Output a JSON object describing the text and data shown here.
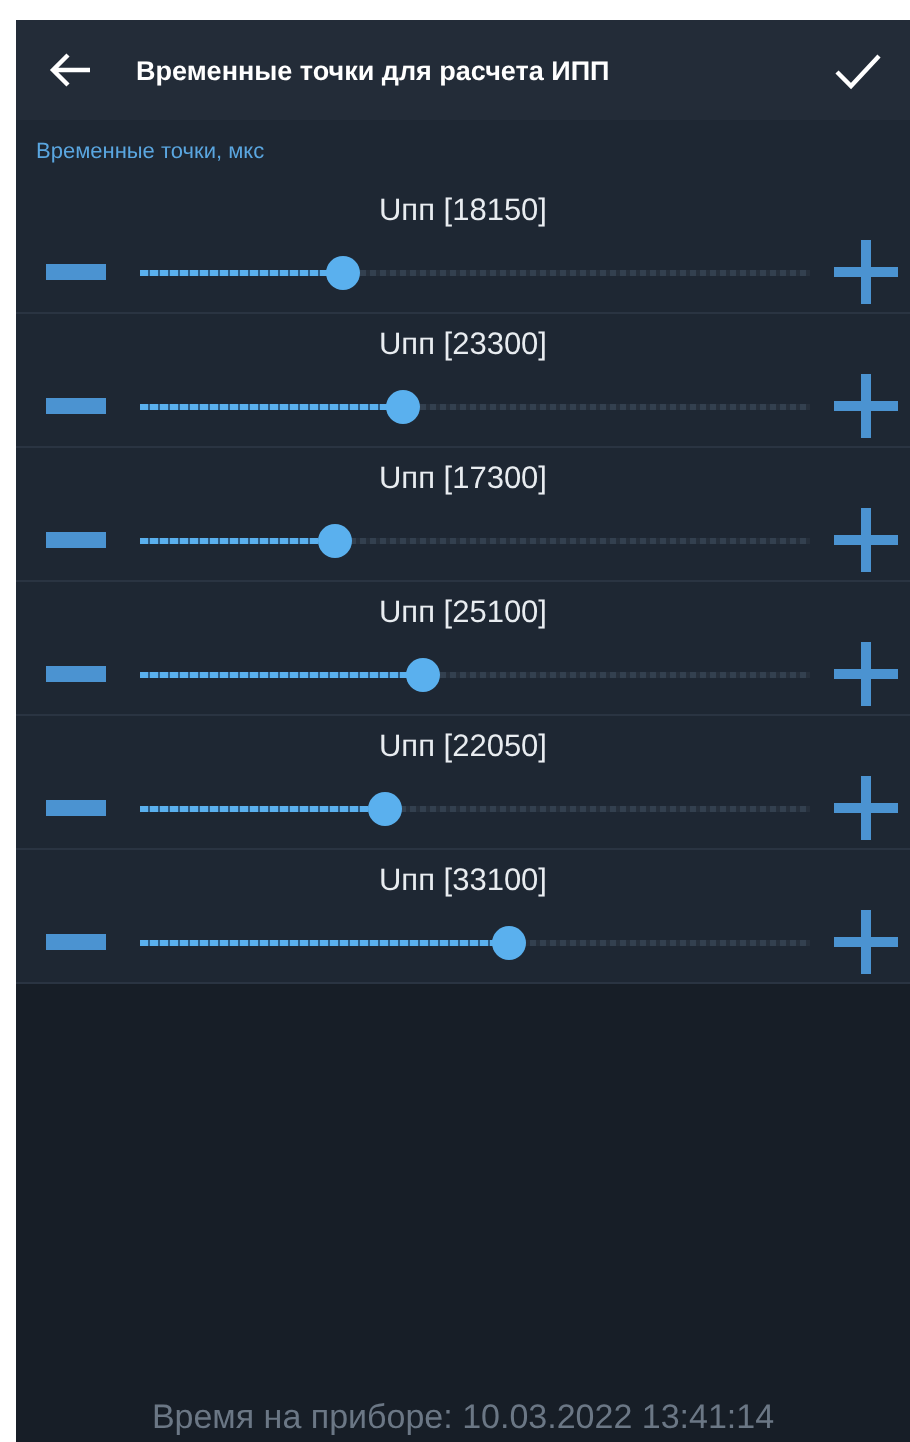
{
  "header": {
    "title": "Временные точки для расчета ИПП"
  },
  "section": {
    "label": "Временные точки, мкс"
  },
  "sliders": [
    {
      "label": "Uпп [18150]",
      "level": 0.3
    },
    {
      "label": "Uпп [23300]",
      "level": 0.39
    },
    {
      "label": "Uпп [17300]",
      "level": 0.29
    },
    {
      "label": "Uпп [25100]",
      "level": 0.42
    },
    {
      "label": "Uпп [22050]",
      "level": 0.365
    },
    {
      "label": "Uпп [33100]",
      "level": 0.55
    }
  ],
  "footer": {
    "device_time": "Время на приборе: 10.03.2022 13:41:14"
  }
}
